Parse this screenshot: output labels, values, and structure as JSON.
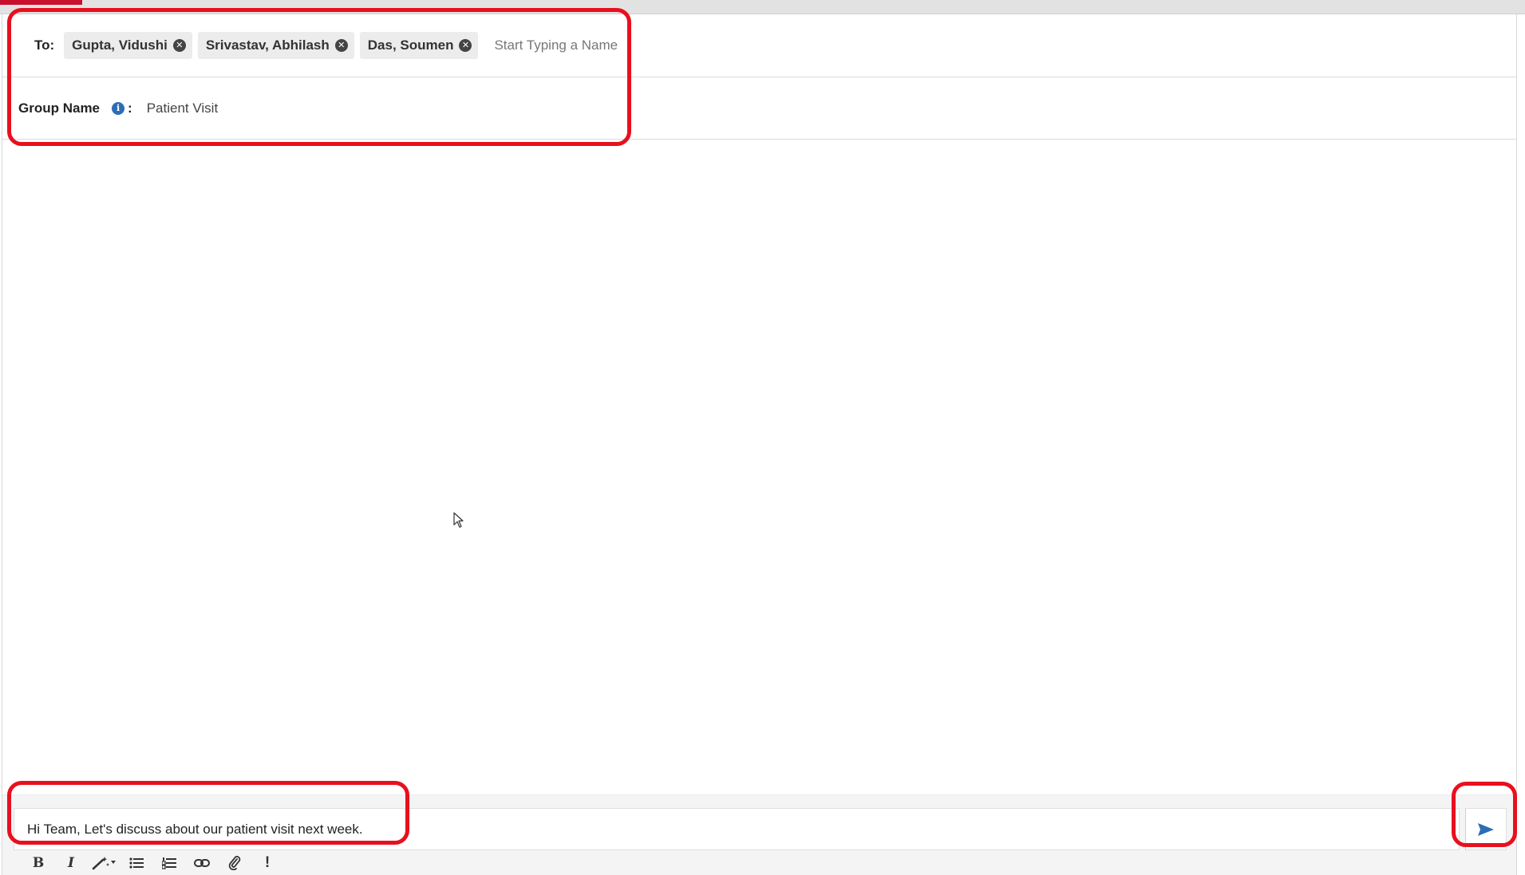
{
  "compose": {
    "to_label": "To:",
    "recipients": [
      {
        "name": "Gupta, Vidushi"
      },
      {
        "name": "Srivastav, Abhilash"
      },
      {
        "name": "Das, Soumen"
      }
    ],
    "to_placeholder": "Start Typing a Name",
    "group_label": "Group Name",
    "group_colon": ":",
    "group_value": "Patient Visit"
  },
  "message": {
    "text": "Hi Team, Let's discuss about our patient visit next week."
  },
  "toolbar": {
    "buttons": [
      {
        "name": "bold-button",
        "icon": "bold-icon",
        "glyph": "B"
      },
      {
        "name": "italic-button",
        "icon": "italic-icon",
        "glyph": "I"
      },
      {
        "name": "magic-format-button",
        "icon": "magic-wand-icon"
      },
      {
        "name": "bullet-list-button",
        "icon": "bullet-list-icon"
      },
      {
        "name": "numbered-list-button",
        "icon": "numbered-list-icon"
      },
      {
        "name": "link-button",
        "icon": "link-icon"
      },
      {
        "name": "attach-button",
        "icon": "paperclip-icon"
      },
      {
        "name": "priority-button",
        "icon": "exclamation-icon",
        "glyph": "!"
      }
    ]
  },
  "colors": {
    "accent_red": "#c8102e",
    "highlight_red": "#e8101e",
    "send_blue": "#2d6db5",
    "info_blue": "#2d6db5"
  }
}
